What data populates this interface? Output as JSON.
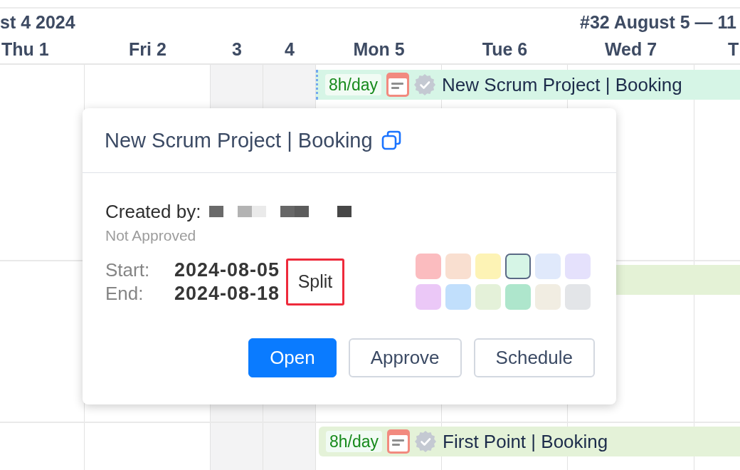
{
  "header": {
    "weeks": [
      {
        "label": "st 4 2024"
      },
      {
        "label": "#32 August 5 — 11"
      }
    ],
    "days": [
      {
        "label": "Thu 1",
        "weekend": false
      },
      {
        "label": "Fri 2",
        "weekend": false
      },
      {
        "label": "3",
        "weekend": true
      },
      {
        "label": "4",
        "weekend": true
      },
      {
        "label": "Mon 5",
        "weekend": false
      },
      {
        "label": "Tue 6",
        "weekend": false
      },
      {
        "label": "Wed 7",
        "weekend": false
      },
      {
        "label": "T",
        "weekend": false
      }
    ]
  },
  "rows": [
    {
      "booking": {
        "hours": "8h/day",
        "title": "New Scrum Project | Booking",
        "color": "#d6f5e6",
        "selected": true
      }
    },
    {
      "booking": {
        "color": "#e4f2d6",
        "selected": false
      }
    },
    {
      "booking": {
        "hours": "8h/day",
        "title": "First Point | Booking",
        "color": "#e4f2d8",
        "selected": false
      }
    }
  ],
  "popup": {
    "title": "New Scrum Project | Booking",
    "created_by_label": "Created by:",
    "approval_status": "Not Approved",
    "start_label": "Start:",
    "start_value": "2024-08-05",
    "end_label": "End:",
    "end_value": "2024-08-18",
    "split_button": "Split",
    "swatches": [
      {
        "color": "#fbbcbf",
        "selected": false
      },
      {
        "color": "#f9dfd0",
        "selected": false
      },
      {
        "color": "#fdf3b5",
        "selected": false
      },
      {
        "color": "#d6f5e6",
        "selected": true
      },
      {
        "color": "#e0e9fb",
        "selected": false
      },
      {
        "color": "#e5e1fc",
        "selected": false
      },
      {
        "color": "#ebc8f7",
        "selected": false
      },
      {
        "color": "#c1dffc",
        "selected": false
      },
      {
        "color": "#e4f1d9",
        "selected": false
      },
      {
        "color": "#aee6cc",
        "selected": false
      },
      {
        "color": "#f1ede2",
        "selected": false
      },
      {
        "color": "#e3e5e8",
        "selected": false
      }
    ],
    "buttons": [
      {
        "label": "Open",
        "kind": "primary"
      },
      {
        "label": "Approve",
        "kind": "secondary"
      },
      {
        "label": "Schedule",
        "kind": "secondary"
      }
    ]
  }
}
